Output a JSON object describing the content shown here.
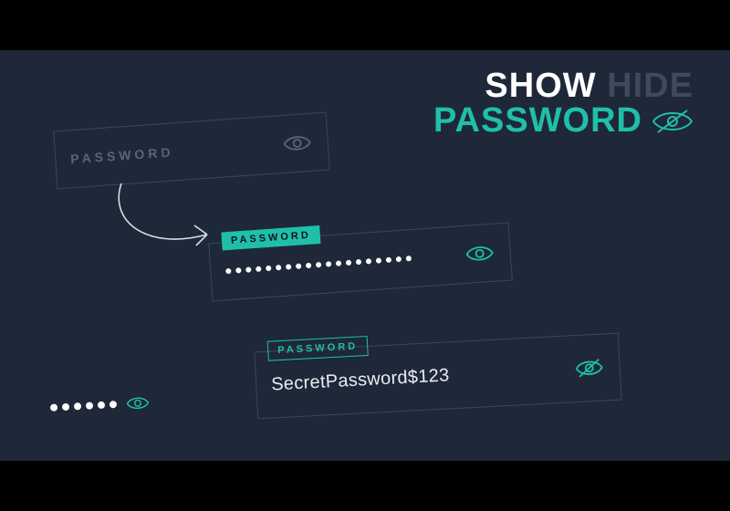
{
  "heading": {
    "show": "SHOW",
    "hide": "HIDE",
    "password": "PASSWORD"
  },
  "fields": {
    "empty": {
      "placeholder": "PASSWORD"
    },
    "masked": {
      "label": "PASSWORD",
      "dot_count": 19
    },
    "revealed": {
      "label": "PASSWORD",
      "value": "SecretPassword$123"
    }
  },
  "mini": {
    "dot_count": 6
  },
  "colors": {
    "accent": "#1fbfa9",
    "bg": "#1e2838",
    "muted": "#5a6678"
  }
}
